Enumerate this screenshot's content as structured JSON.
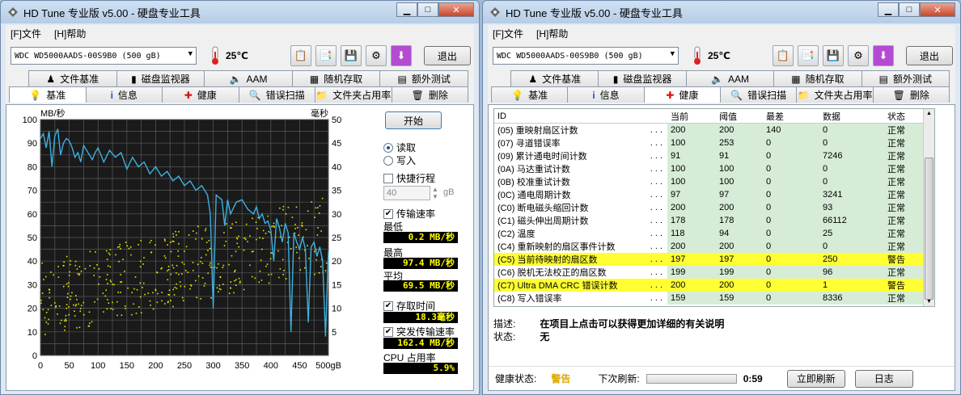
{
  "left": {
    "title": "HD Tune 专业版 v5.00 - 硬盘专业工具",
    "menu": [
      "[F]文件",
      "[H]帮助"
    ],
    "drive": "WDC WD5000AADS-00S9B0 (500 gB)",
    "temperature": "25℃",
    "exit_label": "退出",
    "tabs_top": [
      "文件基准",
      "磁盘监视器",
      "AAM",
      "随机存取",
      "额外测试"
    ],
    "tabs_bottom": [
      "基准",
      "信息",
      "健康",
      "错误扫描",
      "文件夹占用率",
      "删除"
    ],
    "active_tab": "基准",
    "chart_data": {
      "type": "line",
      "ylabel": "MB/秒",
      "ylabel_right": "毫秒",
      "y_ticks": [
        "100",
        "90",
        "80",
        "70",
        "60",
        "50",
        "40",
        "30",
        "20",
        "10",
        "0"
      ],
      "y2_ticks": [
        "50",
        "45",
        "40",
        "35",
        "30",
        "25",
        "20",
        "15",
        "10",
        "5"
      ],
      "x_ticks": [
        "0",
        "50",
        "100",
        "150",
        "200",
        "250",
        "300",
        "350",
        "400",
        "450",
        "500gB"
      ],
      "xlim": [
        0,
        500
      ],
      "ylim": [
        0,
        100
      ],
      "y2lim": [
        0,
        50
      ],
      "series": [
        {
          "name": "传输速率",
          "color": "#3cb0e0",
          "x": [
            0,
            5,
            10,
            15,
            20,
            25,
            30,
            35,
            40,
            45,
            50,
            55,
            60,
            65,
            70,
            75,
            80,
            85,
            90,
            95,
            100,
            110,
            120,
            130,
            140,
            150,
            160,
            170,
            180,
            190,
            200,
            210,
            220,
            230,
            240,
            250,
            260,
            270,
            280,
            290,
            295,
            300,
            305,
            310,
            315,
            320,
            325,
            330,
            340,
            350,
            360,
            370,
            375,
            380,
            385,
            390,
            395,
            400,
            405,
            410,
            415,
            420,
            425,
            430,
            435,
            440,
            445,
            450,
            455,
            460,
            465,
            470,
            475,
            480,
            485,
            490,
            495,
            500
          ],
          "y": [
            92,
            94,
            88,
            95,
            80,
            93,
            96,
            85,
            90,
            92,
            91,
            88,
            84,
            86,
            82,
            89,
            87,
            85,
            83,
            86,
            88,
            82,
            87,
            84,
            86,
            79,
            84,
            80,
            82,
            77,
            80,
            76,
            78,
            74,
            76,
            72,
            74,
            70,
            72,
            68,
            60,
            20,
            68,
            67,
            66,
            55,
            66,
            60,
            65,
            66,
            62,
            60,
            63,
            58,
            60,
            56,
            57,
            53,
            40,
            58,
            54,
            48,
            56,
            52,
            10,
            52,
            48,
            45,
            50,
            45,
            14,
            46,
            48,
            42,
            46,
            40,
            8,
            44
          ]
        }
      ],
      "access_points_color": "#e8e800"
    },
    "side": {
      "start_label": "开始",
      "read_label": "读取",
      "write_label": "写入",
      "quick_label": "快捷行程",
      "quick_value": "40",
      "quick_unit": "gB",
      "transfer_label": "传输速率",
      "min_label": "最低",
      "min_value": "0.2 MB/秒",
      "max_label": "最高",
      "max_value": "97.4 MB/秒",
      "avg_label": "平均",
      "avg_value": "69.5 MB/秒",
      "access_label": "存取时间",
      "access_value": "18.3毫秒",
      "burst_label": "突发传输速率",
      "burst_value": "162.4 MB/秒",
      "cpu_label": "CPU 占用率",
      "cpu_value": "5.9%"
    }
  },
  "right": {
    "title": "HD Tune 专业版 v5.00 - 硬盘专业工具",
    "menu": [
      "[F]文件",
      "[H]帮助"
    ],
    "drive": "WDC WD5000AADS-00S9B0 (500 gB)",
    "temperature": "25℃",
    "exit_label": "退出",
    "tabs_top": [
      "文件基准",
      "磁盘监视器",
      "AAM",
      "随机存取",
      "额外测试"
    ],
    "tabs_bottom": [
      "基准",
      "信息",
      "健康",
      "错误扫描",
      "文件夹占用率",
      "删除"
    ],
    "active_tab": "健康",
    "table_headers": [
      "ID",
      "当前",
      "阈值",
      "最差",
      "数据",
      "状态"
    ],
    "rows": [
      {
        "id": "(05) 重映射扇区计数",
        "cur": "200",
        "thr": "200",
        "worst": "140",
        "data": "0",
        "stat": "正常",
        "warn": false
      },
      {
        "id": "(07) 寻道错误率",
        "cur": "100",
        "thr": "253",
        "worst": "0",
        "data": "0",
        "stat": "正常",
        "warn": false
      },
      {
        "id": "(09) 累计通电时间计数",
        "cur": "91",
        "thr": "91",
        "worst": "0",
        "data": "7246",
        "stat": "正常",
        "warn": false
      },
      {
        "id": "(0A) 马达重试计数",
        "cur": "100",
        "thr": "100",
        "worst": "0",
        "data": "0",
        "stat": "正常",
        "warn": false
      },
      {
        "id": "(0B) 校准重试计数",
        "cur": "100",
        "thr": "100",
        "worst": "0",
        "data": "0",
        "stat": "正常",
        "warn": false
      },
      {
        "id": "(0C) 通电周期计数",
        "cur": "97",
        "thr": "97",
        "worst": "0",
        "data": "3241",
        "stat": "正常",
        "warn": false
      },
      {
        "id": "(C0) 断电磁头缩回计数",
        "cur": "200",
        "thr": "200",
        "worst": "0",
        "data": "93",
        "stat": "正常",
        "warn": false
      },
      {
        "id": "(C1) 磁头伸出周期计数",
        "cur": "178",
        "thr": "178",
        "worst": "0",
        "data": "66112",
        "stat": "正常",
        "warn": false
      },
      {
        "id": "(C2) 温度",
        "cur": "118",
        "thr": "94",
        "worst": "0",
        "data": "25",
        "stat": "正常",
        "warn": false
      },
      {
        "id": "(C4) 重新映射的扇区事件计数",
        "cur": "200",
        "thr": "200",
        "worst": "0",
        "data": "0",
        "stat": "正常",
        "warn": false
      },
      {
        "id": "(C5) 当前待映射的扇区数",
        "cur": "197",
        "thr": "197",
        "worst": "0",
        "data": "250",
        "stat": "警告",
        "warn": true
      },
      {
        "id": "(C6) 脱机无法校正的扇区数",
        "cur": "199",
        "thr": "199",
        "worst": "0",
        "data": "96",
        "stat": "正常",
        "warn": false
      },
      {
        "id": "(C7) Ultra DMA CRC 错误计数",
        "cur": "200",
        "thr": "200",
        "worst": "0",
        "data": "1",
        "stat": "警告",
        "warn": true
      },
      {
        "id": "(C8) 写入错误率",
        "cur": "159",
        "thr": "159",
        "worst": "0",
        "data": "8336",
        "stat": "正常",
        "warn": false
      }
    ],
    "dots": ". . .",
    "desc_label": "描述:",
    "desc_value": "在项目上点击可以获得更加详细的有关说明",
    "state_label": "状态:",
    "state_value": "无",
    "health_label": "健康状态:",
    "health_value": "警告",
    "next_refresh_label": "下次刷新:",
    "next_refresh_value": "0:59",
    "refresh_button": "立即刷新",
    "log_button": "日志"
  }
}
